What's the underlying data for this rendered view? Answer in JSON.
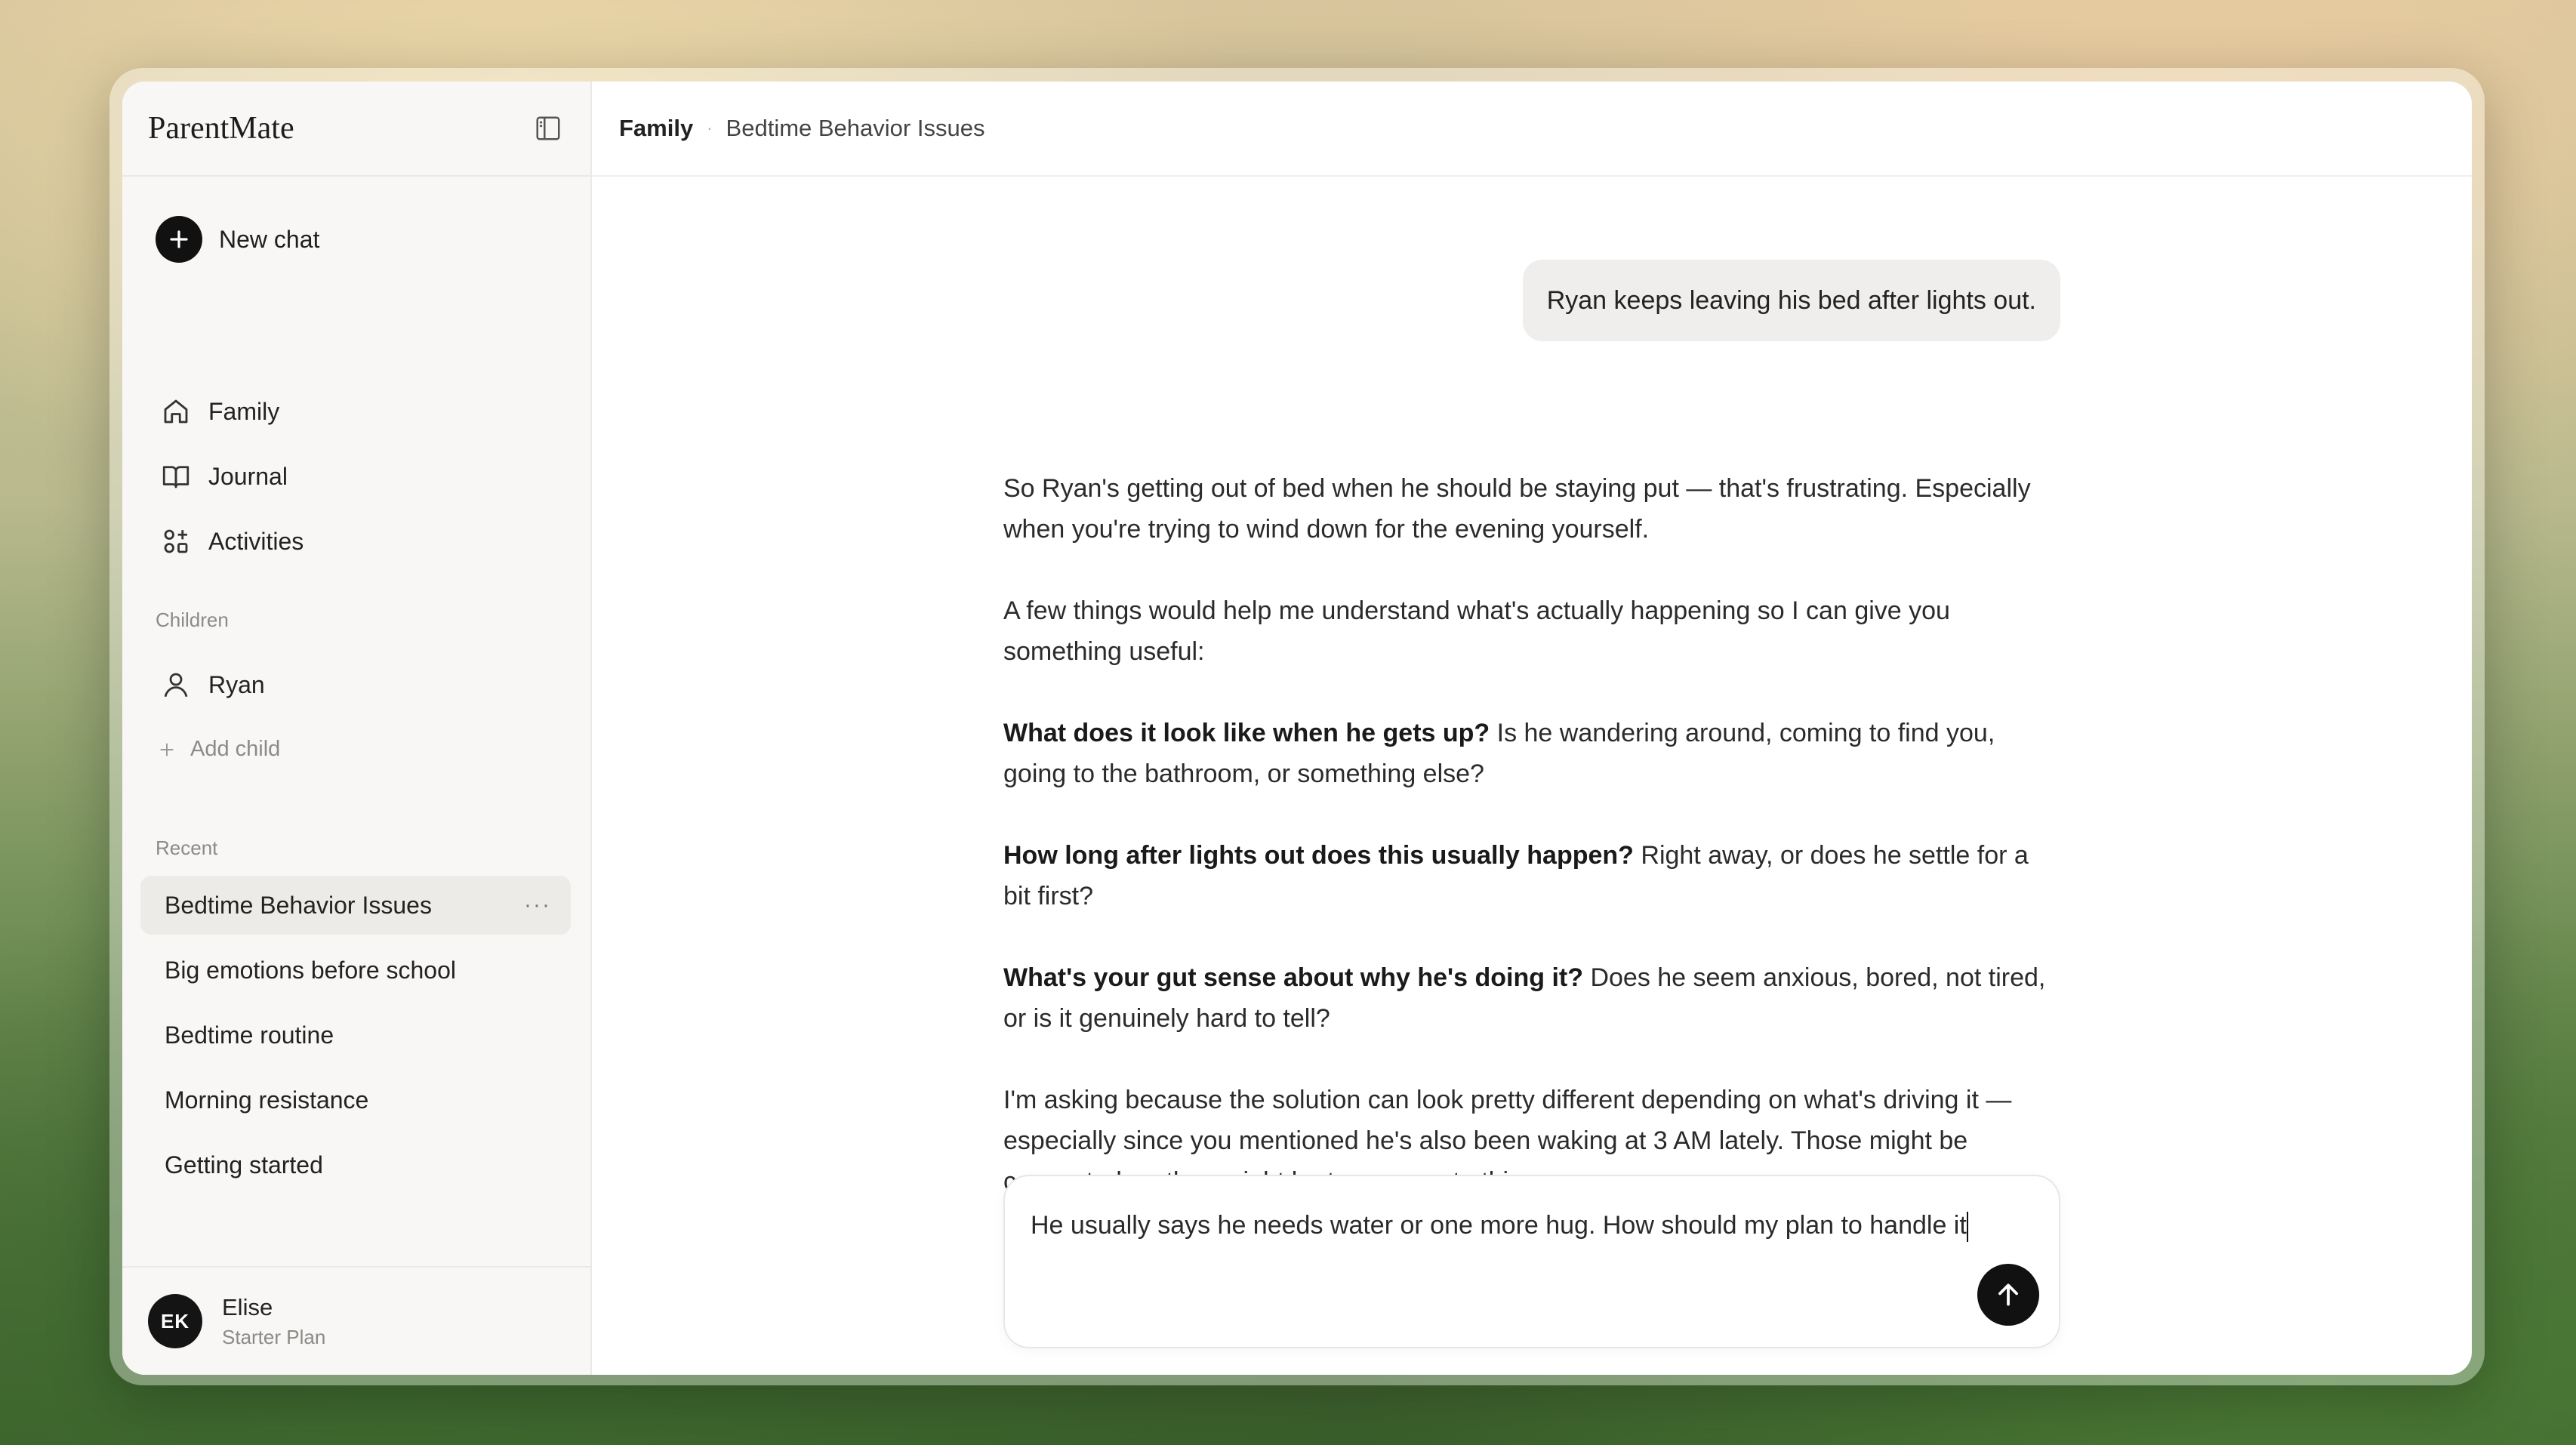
{
  "app": {
    "name": "ParentMate"
  },
  "sidebar": {
    "new_chat": "New chat",
    "nav": [
      {
        "label": "Family",
        "icon": "home-icon"
      },
      {
        "label": "Journal",
        "icon": "book-icon"
      },
      {
        "label": "Activities",
        "icon": "grid-plus-icon"
      }
    ],
    "children_label": "Children",
    "children": [
      {
        "label": "Ryan",
        "icon": "person-icon"
      }
    ],
    "add_child": "Add child",
    "recent_label": "Recent",
    "recent": [
      {
        "label": "Bedtime Behavior Issues",
        "active": true
      },
      {
        "label": "Big emotions before school"
      },
      {
        "label": "Bedtime routine"
      },
      {
        "label": "Morning resistance"
      },
      {
        "label": "Getting started"
      }
    ],
    "more": "···",
    "user": {
      "initials": "EK",
      "name": "Elise",
      "plan": "Starter Plan"
    }
  },
  "breadcrumb": {
    "root": "Family",
    "sep": "·",
    "current": "Bedtime Behavior Issues"
  },
  "conversation": {
    "user_message": "Ryan keeps leaving his bed after lights out.",
    "reply": {
      "p1": "So Ryan's getting out of bed when he should be staying put — that's frustrating. Especially when you're trying to wind down for the evening yourself.",
      "p2": "A few things would help me understand what's actually happening so I can give you something useful:",
      "q1_bold": "What does it look like when he gets up?",
      "q1_rest": " Is he wandering around, coming to find you, going to the bathroom, or something else?",
      "q2_bold": "How long after lights out does this usually happen?",
      "q2_rest": " Right away, or does he settle for a bit first?",
      "q3_bold": "What's your gut sense about why he's doing it?",
      "q3_rest": " Does he seem anxious, bored, not tired, or is it genuinely hard to tell?",
      "p_end": "I'm asking because the solution can look pretty different depending on what's driving it — especially since you mentioned he's also been waking at 3 AM lately. Those might be connected, or they might be two separate things."
    }
  },
  "composer": {
    "value": "He usually says he needs water or one more hug. How should my plan to handle it"
  }
}
